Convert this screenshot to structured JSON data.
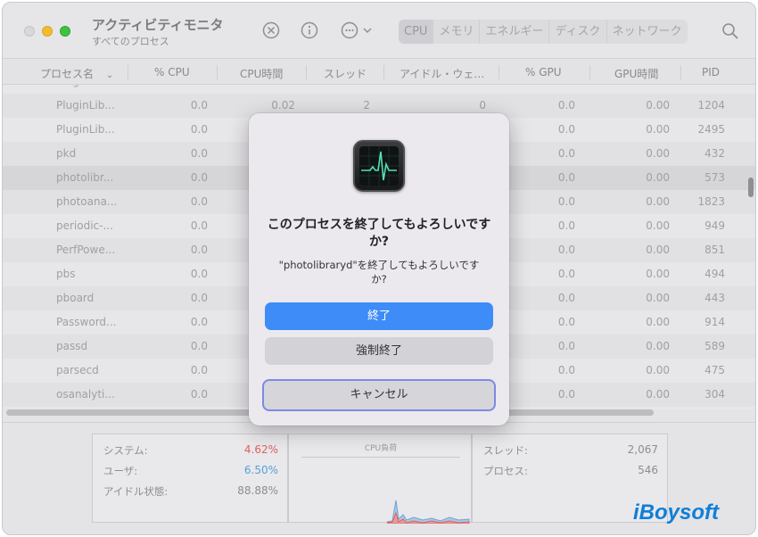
{
  "window": {
    "title": "アクティビティモニタ",
    "subtitle": "すべてのプロセス"
  },
  "toolbar": {
    "icons": [
      "stop-icon",
      "info-icon",
      "more-icon"
    ],
    "tabs": [
      "CPU",
      "メモリ",
      "エネルギー",
      "ディスク",
      "ネットワーク"
    ],
    "active_tab": "CPU"
  },
  "columns": {
    "name": "プロセス名",
    "cpu": "% CPU",
    "cpu_time": "CPU時間",
    "threads": "スレッド",
    "idle_wakeups": "アイドル・ウェ…",
    "gpu": "% GPU",
    "gpu_time": "GPU時間",
    "pid": "PID"
  },
  "rows": [
    {
      "name": "PluginLib...",
      "cpu": "0.0",
      "cpu_time": "0.02",
      "threads": "2",
      "idle": "0",
      "gpu": "0.0",
      "gpu_time": "0.00",
      "pid": "1204"
    },
    {
      "name": "PluginLib...",
      "cpu": "0.0",
      "cpu_time": "",
      "threads": "",
      "idle": "",
      "gpu": "0.0",
      "gpu_time": "0.00",
      "pid": "2495"
    },
    {
      "name": "pkd",
      "cpu": "0.0",
      "cpu_time": "",
      "threads": "",
      "idle": "",
      "gpu": "0.0",
      "gpu_time": "0.00",
      "pid": "432"
    },
    {
      "name": "photolibr...",
      "cpu": "0.0",
      "cpu_time": "",
      "threads": "",
      "idle": "",
      "gpu": "0.0",
      "gpu_time": "0.00",
      "pid": "573"
    },
    {
      "name": "photoana...",
      "cpu": "0.0",
      "cpu_time": "",
      "threads": "",
      "idle": "",
      "gpu": "0.0",
      "gpu_time": "0.00",
      "pid": "1823"
    },
    {
      "name": "periodic-...",
      "cpu": "0.0",
      "cpu_time": "",
      "threads": "",
      "idle": "",
      "gpu": "0.0",
      "gpu_time": "0.00",
      "pid": "949"
    },
    {
      "name": "PerfPowe...",
      "cpu": "0.0",
      "cpu_time": "",
      "threads": "",
      "idle": "",
      "gpu": "0.0",
      "gpu_time": "0.00",
      "pid": "851"
    },
    {
      "name": "pbs",
      "cpu": "0.0",
      "cpu_time": "",
      "threads": "",
      "idle": "",
      "gpu": "0.0",
      "gpu_time": "0.00",
      "pid": "494"
    },
    {
      "name": "pboard",
      "cpu": "0.0",
      "cpu_time": "",
      "threads": "",
      "idle": "",
      "gpu": "0.0",
      "gpu_time": "0.00",
      "pid": "443"
    },
    {
      "name": "Password...",
      "cpu": "0.0",
      "cpu_time": "",
      "threads": "",
      "idle": "",
      "gpu": "0.0",
      "gpu_time": "0.00",
      "pid": "914"
    },
    {
      "name": "passd",
      "cpu": "0.0",
      "cpu_time": "",
      "threads": "",
      "idle": "",
      "gpu": "0.0",
      "gpu_time": "0.00",
      "pid": "589"
    },
    {
      "name": "parsecd",
      "cpu": "0.0",
      "cpu_time": "",
      "threads": "",
      "idle": "",
      "gpu": "0.0",
      "gpu_time": "0.00",
      "pid": "475"
    },
    {
      "name": "osanalyti...",
      "cpu": "0.0",
      "cpu_time": "",
      "threads": "",
      "idle": "",
      "gpu": "0.0",
      "gpu_time": "0.00",
      "pid": "304"
    }
  ],
  "summary": {
    "system_label": "システム:",
    "system_value": "4.62%",
    "user_label": "ユーザ:",
    "user_value": "6.50%",
    "idle_label": "アイドル状態:",
    "idle_value": "88.88%",
    "cpu_load_title": "CPU負荷",
    "threads_label": "スレッド:",
    "threads_value": "2,067",
    "processes_label": "プロセス:",
    "processes_value": "546",
    "system_color": "#e0615f",
    "user_color": "#5aa0d8"
  },
  "dialog": {
    "title": "このプロセスを終了してもよろしいですか?",
    "message": "\"photolibraryd\"を終了してもよろしいですか?",
    "quit_label": "終了",
    "force_quit_label": "強制終了",
    "cancel_label": "キャンセル",
    "primary_color": "#3d8cf7"
  },
  "watermark": "iBoysoft"
}
